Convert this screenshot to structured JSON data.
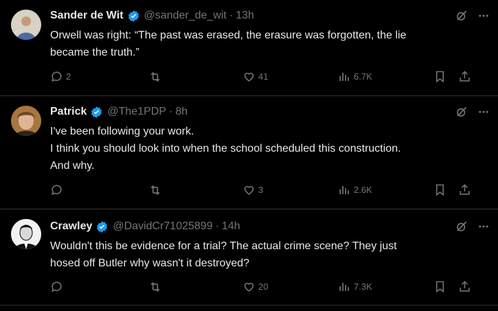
{
  "tweets": [
    {
      "name": "Sander de Wit",
      "handle": "@sander_de_wit",
      "separator": "·",
      "time": "13h",
      "lines": [
        "Orwell was right: “The past was erased, the erasure was forgotten, the lie",
        "became the truth.”"
      ],
      "replies": "2",
      "reposts": "",
      "likes": "41",
      "views": "6.7K",
      "avatar_colors": [
        "#c9c2b3",
        "#4a6aa8"
      ]
    },
    {
      "name": "Patrick",
      "handle": "@The1PDP",
      "separator": "·",
      "time": "8h",
      "lines": [
        "I've been following your work.",
        "I think you should look into when the school scheduled this construction.",
        "And why."
      ],
      "replies": "",
      "reposts": "",
      "likes": "3",
      "views": "2.6K",
      "avatar_colors": [
        "#a8773f",
        "#2b2520"
      ]
    },
    {
      "name": "Crawley",
      "handle": "@DavidCr71025899",
      "separator": "·",
      "time": "14h",
      "lines": [
        "Wouldn't this be evidence for a trial? The actual crime scene? They just",
        "hosed off Butler why wasn't it destroyed?"
      ],
      "replies": "",
      "reposts": "",
      "likes": "20",
      "views": "7.3K",
      "avatar_colors": [
        "#f2f2f2",
        "#111111"
      ]
    }
  ],
  "icons": {
    "verified": "verified-badge-icon",
    "grok": "grok-icon",
    "more": "more-icon",
    "reply": "reply-icon",
    "repost": "repost-icon",
    "like": "like-icon",
    "views": "views-icon",
    "bookmark": "bookmark-icon",
    "share": "share-icon"
  },
  "colors": {
    "background": "#000000",
    "text": "#e7e9ea",
    "muted": "#71767b",
    "verified": "#1d9bf0",
    "divider": "#2f3336"
  }
}
